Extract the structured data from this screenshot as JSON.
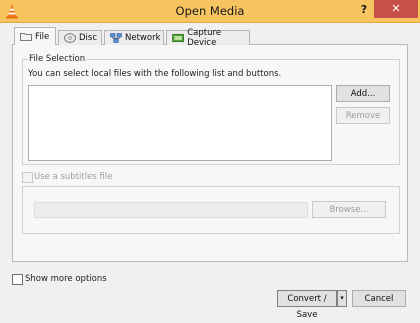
{
  "window": {
    "title": "Open Media",
    "help_label": "?",
    "close_label": "✕",
    "titlebar_color": "#f6c560",
    "close_color": "#c7504b"
  },
  "tabs": [
    {
      "label": "File",
      "icon": "folder-icon",
      "active": true
    },
    {
      "label": "Disc",
      "icon": "disc-icon",
      "active": false
    },
    {
      "label": "Network",
      "icon": "network-icon",
      "active": false
    },
    {
      "label": "Capture Device",
      "icon": "capture-device-icon",
      "active": false
    }
  ],
  "file_selection": {
    "group_title": "File Selection",
    "description": "You can select local files with the following list and buttons.",
    "add_label": "Add...",
    "remove_label": "Remove"
  },
  "subtitles": {
    "checkbox_label": "Use a subtitles file",
    "browse_label": "Browse..."
  },
  "footer": {
    "show_more_label": "Show more options",
    "convert_label": "Convert / Save",
    "dropdown_arrow": "▾",
    "cancel_label": "Cancel"
  }
}
